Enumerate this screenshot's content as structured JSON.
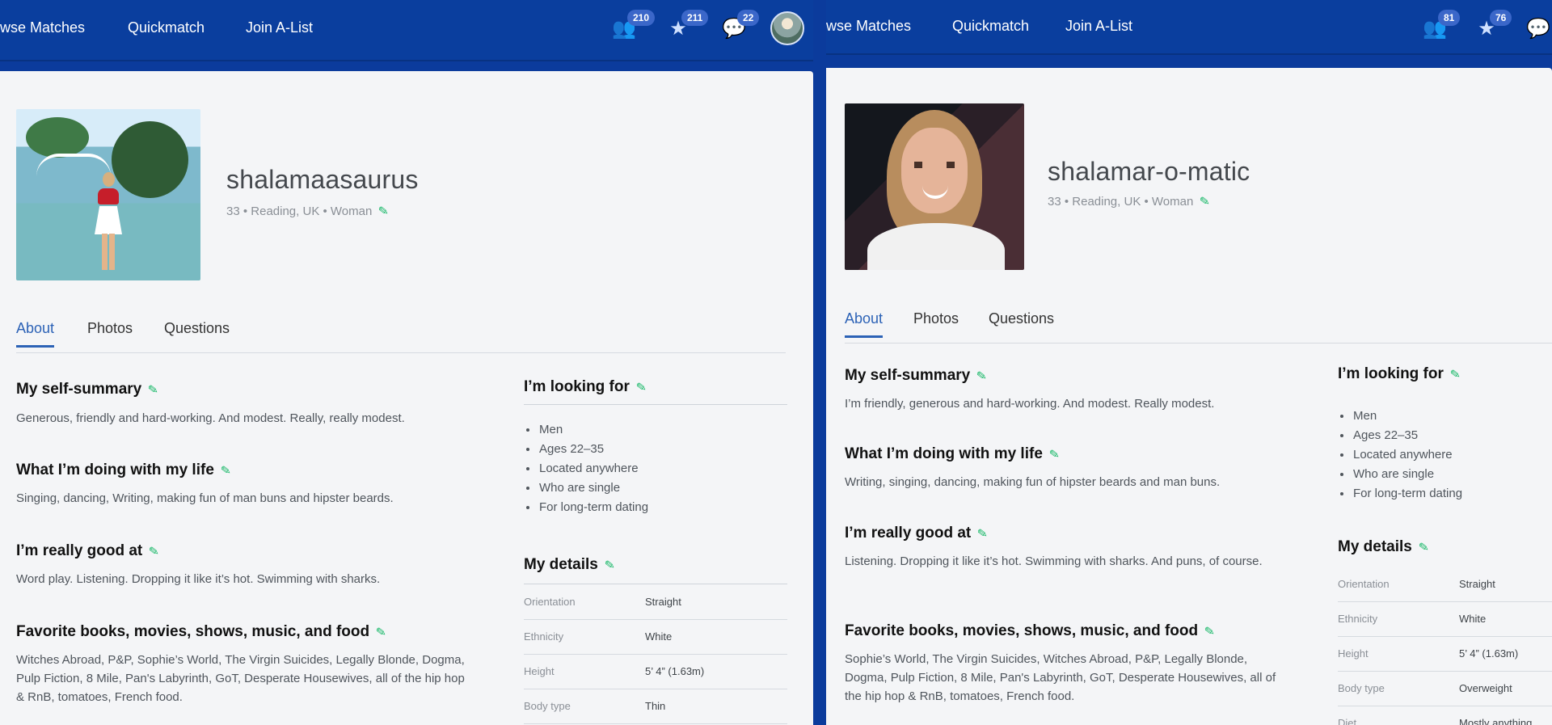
{
  "left_profile": {
    "nav": {
      "browse_matches": "wse Matches",
      "quickmatch": "Quickmatch",
      "join_alist": "Join A-List",
      "likes_count": "210",
      "stars_count": "211",
      "messages_count": "22"
    },
    "profile": {
      "username": "shalamaasaurus",
      "meta": "33 • Reading, UK • Woman"
    },
    "tabs": [
      "About",
      "Photos",
      "Questions"
    ],
    "sections": [
      {
        "title": "My self-summary",
        "body": "Generous, friendly and hard-working. And modest. Really, really modest."
      },
      {
        "title": "What I’m doing with my life",
        "body": "Singing, dancing, Writing, making fun of man buns and hipster beards."
      },
      {
        "title": "I’m really good at",
        "body": "Word play. Listening. Dropping it like it’s hot. Swimming with sharks."
      },
      {
        "title": "Favorite books, movies, shows, music, and food",
        "body": "Witches Abroad, P&P, Sophie’s World, The Virgin Suicides, Legally Blonde, Dogma, Pulp Fiction, 8 Mile, Pan's Labyrinth, GoT, Desperate Housewives, all of the hip hop & RnB, tomatoes, French food."
      }
    ],
    "looking_for": {
      "title": "I’m looking for",
      "items": [
        "Men",
        "Ages 22–35",
        "Located anywhere",
        "Who are single",
        "For long-term dating"
      ]
    },
    "details": {
      "title": "My details",
      "rows": [
        {
          "label": "Orientation",
          "value": "Straight"
        },
        {
          "label": "Ethnicity",
          "value": "White"
        },
        {
          "label": "Height",
          "value": "5’ 4” (1.63m)"
        },
        {
          "label": "Body type",
          "value": "Thin"
        }
      ]
    }
  },
  "right_profile": {
    "nav": {
      "browse_matches": "wse Matches",
      "quickmatch": "Quickmatch",
      "join_alist": "Join A-List",
      "likes_count": "81",
      "stars_count": "76"
    },
    "profile": {
      "username": "shalamar-o-matic",
      "meta": "33 • Reading, UK • Woman"
    },
    "tabs": [
      "About",
      "Photos",
      "Questions"
    ],
    "sections": [
      {
        "title": "My self-summary",
        "body": "I’m friendly, generous and hard-working. And modest. Really modest."
      },
      {
        "title": "What I’m doing with my life",
        "body": "Writing, singing, dancing, making fun of hipster beards and man buns."
      },
      {
        "title": "I’m really good at",
        "body": "Listening. Dropping it like it’s hot. Swimming with sharks. And puns, of course."
      },
      {
        "title": "Favorite books, movies, shows, music, and food",
        "body": "Sophie’s World, The Virgin Suicides, Witches Abroad, P&P, Legally Blonde, Dogma, Pulp Fiction, 8 Mile, Pan's Labyrinth, GoT, Desperate Housewives, all of the hip hop & RnB, tomatoes, French food."
      }
    ],
    "looking_for": {
      "title": "I’m looking for",
      "items": [
        "Men",
        "Ages 22–35",
        "Located anywhere",
        "Who are single",
        "For long-term dating"
      ]
    },
    "details": {
      "title": "My details",
      "rows": [
        {
          "label": "Orientation",
          "value": "Straight"
        },
        {
          "label": "Ethnicity",
          "value": "White"
        },
        {
          "label": "Height",
          "value": "5’ 4” (1.63m)"
        },
        {
          "label": "Body type",
          "value": "Overweight"
        },
        {
          "label": "Diet",
          "value": "Mostly anything"
        }
      ]
    }
  },
  "colors": {
    "nav_blue": "#0a3e9e",
    "badge_blue": "#3b67c9",
    "edit_green": "#18b868",
    "tab_active": "#2c62b6"
  },
  "icons": [
    "likes-icon",
    "stars-icon",
    "messages-icon",
    "edit-icon"
  ]
}
